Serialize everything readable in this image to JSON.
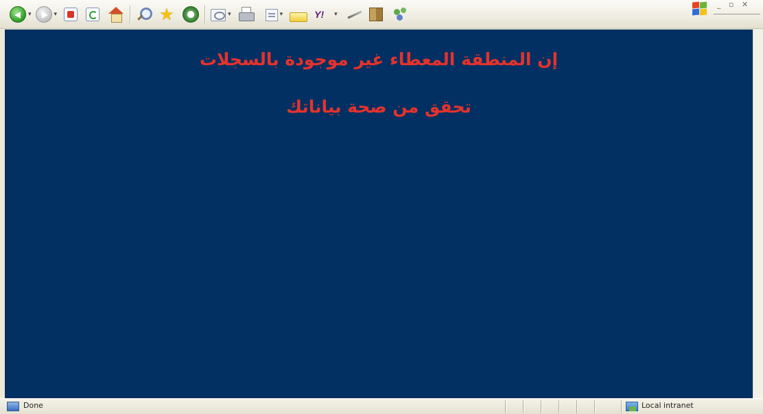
{
  "toolbar": {
    "buttons": [
      {
        "name": "back-button",
        "icon": "back-arrow-icon"
      },
      {
        "name": "forward-button",
        "icon": "forward-arrow-icon"
      },
      {
        "name": "stop-button",
        "icon": "stop-icon"
      },
      {
        "name": "refresh-button",
        "icon": "refresh-icon"
      },
      {
        "name": "home-button",
        "icon": "home-icon"
      },
      {
        "name": "search-button",
        "icon": "search-icon"
      },
      {
        "name": "favorites-button",
        "icon": "star-icon"
      },
      {
        "name": "history-button",
        "icon": "history-icon"
      },
      {
        "name": "mail-button",
        "icon": "mail-icon"
      },
      {
        "name": "print-button",
        "icon": "printer-icon"
      },
      {
        "name": "edit-button",
        "icon": "edit-icon"
      },
      {
        "name": "discuss-button",
        "icon": "note-icon"
      },
      {
        "name": "yahoo-button",
        "icon": "yahoo-icon",
        "label": "Y!"
      },
      {
        "name": "research-button",
        "icon": "pen-icon"
      },
      {
        "name": "book-button",
        "icon": "book-icon"
      },
      {
        "name": "messenger-button",
        "icon": "messenger-icon"
      }
    ],
    "caption_buttons": "_ ▫ ✕"
  },
  "content": {
    "background": "#023062",
    "text_color": "#E5322C",
    "line1": "إن المنطقة المعطاء غير موجودة بالسجلات",
    "line2": "تحقق من صحة بياناتك"
  },
  "statusbar": {
    "left_text": "Done",
    "zone_text": "Local intranet"
  }
}
